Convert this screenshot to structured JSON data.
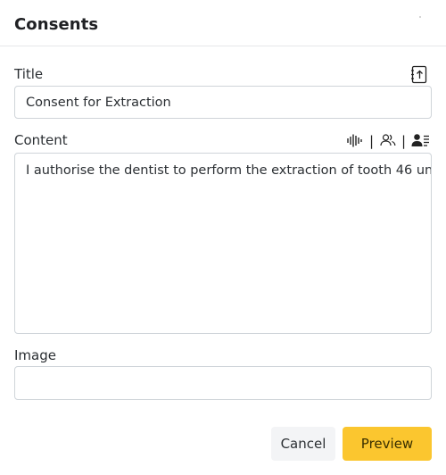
{
  "dialog": {
    "title": "Consents"
  },
  "form": {
    "title_label": "Title",
    "title_value": "Consent for Extraction",
    "content_label": "Content",
    "content_value": "I authorise the dentist to perform the extraction of tooth 46 un",
    "content_toolbar_separator": "|",
    "image_label": "Image",
    "image_value": ""
  },
  "icons": {
    "upload": "upload-document-icon",
    "audio": "audio-waveform-icon",
    "users": "users-icon",
    "patient": "patient-card-icon"
  },
  "footer": {
    "cancel_label": "Cancel",
    "preview_label": "Preview"
  },
  "colors": {
    "primary": "#fbc62f",
    "cancel_bg": "#f3f4f6",
    "border": "#cfd4d9"
  }
}
